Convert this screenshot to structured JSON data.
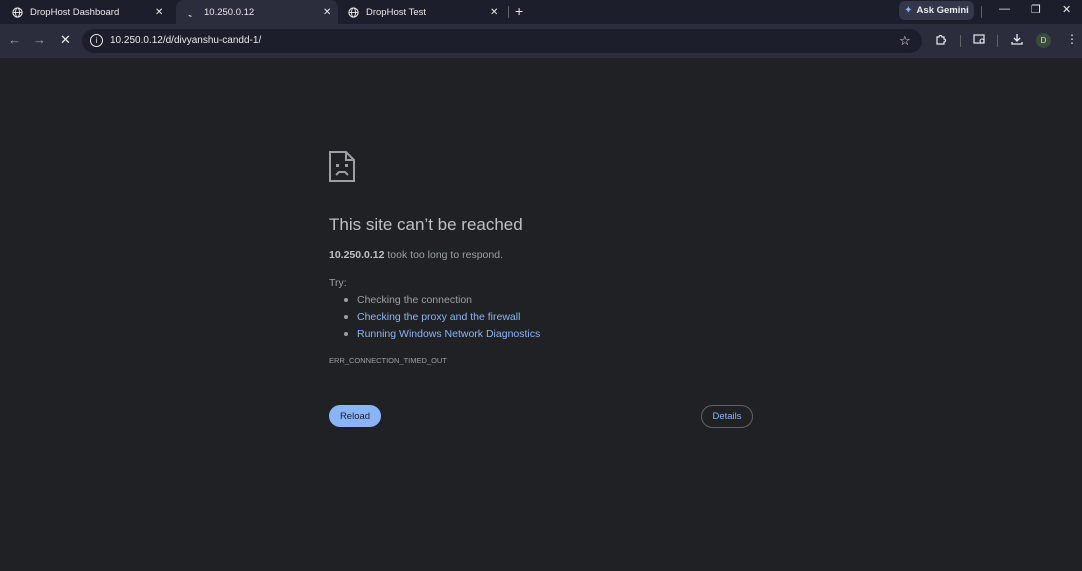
{
  "tabs": [
    {
      "title": "DropHost Dashboard",
      "active": false,
      "icon": "globe-icon"
    },
    {
      "title": "10.250.0.12",
      "active": true,
      "icon": "loading-icon"
    },
    {
      "title": "DropHost Test",
      "active": false,
      "icon": "globe-icon"
    }
  ],
  "tab_close_glyph": "✕",
  "new_tab_glyph": "+",
  "gemini": {
    "label": "Ask Gemini"
  },
  "window_controls": {
    "minimize": "—",
    "restore": "❐",
    "close": "✕"
  },
  "toolbar": {
    "back": "←",
    "forward": "→",
    "stop": "✕",
    "url": "10.250.0.12/d/divyanshu-candd-1/",
    "avatar_letter": "D"
  },
  "error": {
    "title": "This site can’t be reached",
    "host": "10.250.0.12",
    "description": " took too long to respond.",
    "try_label": "Try:",
    "suggestions": [
      {
        "text": "Checking the connection",
        "link": false
      },
      {
        "text": "Checking the proxy and the firewall",
        "link": true
      },
      {
        "text": "Running Windows Network Diagnostics",
        "link": true
      }
    ],
    "code": "ERR_CONNECTION_TIMED_OUT",
    "reload_label": "Reload",
    "details_label": "Details"
  },
  "colors": {
    "background": "#202124",
    "tabstrip": "#1d1e2b",
    "toolbar": "#2b2c3c",
    "link": "#8ab4f8",
    "button": "#8ab4f8"
  }
}
